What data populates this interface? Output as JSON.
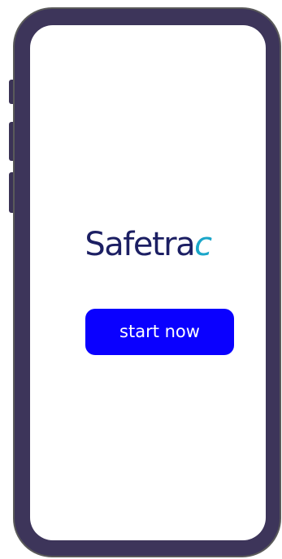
{
  "brand": {
    "logo_main": "Safetra",
    "logo_accent": "c",
    "primary_color": "#1c1f63",
    "accent_color": "#1aa6c9"
  },
  "actions": {
    "start_label": "start now",
    "start_color": "#0a00ff"
  },
  "device": {
    "frame_color": "#3d355a"
  }
}
